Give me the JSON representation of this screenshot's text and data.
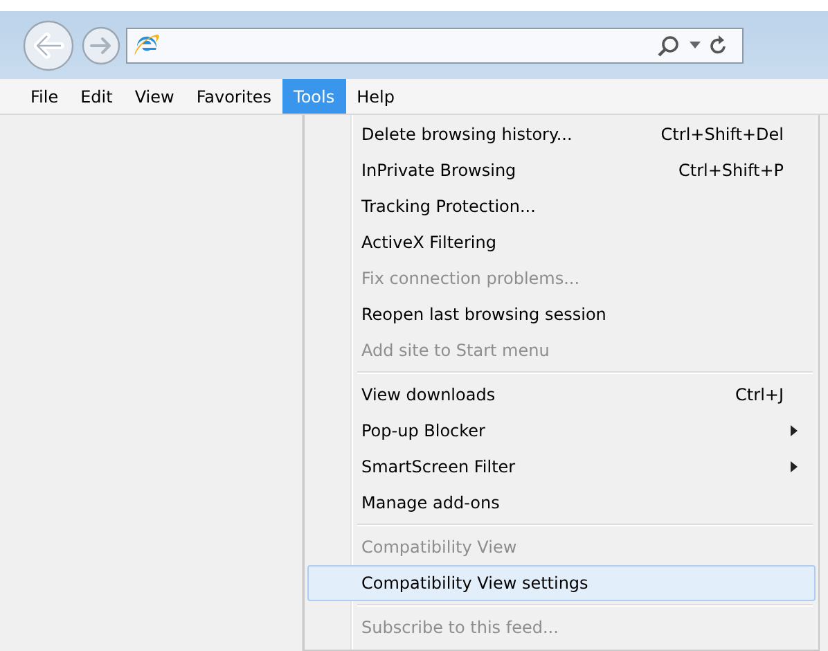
{
  "menu_bar": [
    {
      "label": "File",
      "selected": false
    },
    {
      "label": "Edit",
      "selected": false
    },
    {
      "label": "View",
      "selected": false
    },
    {
      "label": "Favorites",
      "selected": false
    },
    {
      "label": "Tools",
      "selected": true
    },
    {
      "label": "Help",
      "selected": false
    }
  ],
  "tools_menu": [
    {
      "kind": "item",
      "label": "Delete browsing history...",
      "shortcut": "Ctrl+Shift+Del",
      "disabled": false,
      "submenu": false,
      "selected": false
    },
    {
      "kind": "item",
      "label": "InPrivate Browsing",
      "shortcut": "Ctrl+Shift+P",
      "disabled": false,
      "submenu": false,
      "selected": false
    },
    {
      "kind": "item",
      "label": "Tracking Protection...",
      "disabled": false,
      "submenu": false,
      "selected": false
    },
    {
      "kind": "item",
      "label": "ActiveX Filtering",
      "disabled": false,
      "submenu": false,
      "selected": false
    },
    {
      "kind": "item",
      "label": "Fix connection problems...",
      "disabled": true,
      "submenu": false,
      "selected": false
    },
    {
      "kind": "item",
      "label": "Reopen last browsing session",
      "disabled": false,
      "submenu": false,
      "selected": false
    },
    {
      "kind": "item",
      "label": "Add site to Start menu",
      "disabled": true,
      "submenu": false,
      "selected": false
    },
    {
      "kind": "separator"
    },
    {
      "kind": "item",
      "label": "View downloads",
      "shortcut": "Ctrl+J",
      "disabled": false,
      "submenu": false,
      "selected": false
    },
    {
      "kind": "item",
      "label": "Pop-up Blocker",
      "disabled": false,
      "submenu": true,
      "selected": false
    },
    {
      "kind": "item",
      "label": "SmartScreen Filter",
      "disabled": false,
      "submenu": true,
      "selected": false
    },
    {
      "kind": "item",
      "label": "Manage add-ons",
      "disabled": false,
      "submenu": false,
      "selected": false
    },
    {
      "kind": "separator"
    },
    {
      "kind": "item",
      "label": "Compatibility View",
      "disabled": true,
      "submenu": false,
      "selected": false
    },
    {
      "kind": "item",
      "label": "Compatibility View settings",
      "disabled": false,
      "submenu": false,
      "selected": true
    },
    {
      "kind": "separator"
    },
    {
      "kind": "item",
      "label": "Subscribe to this feed...",
      "disabled": true,
      "submenu": false,
      "selected": false
    }
  ]
}
